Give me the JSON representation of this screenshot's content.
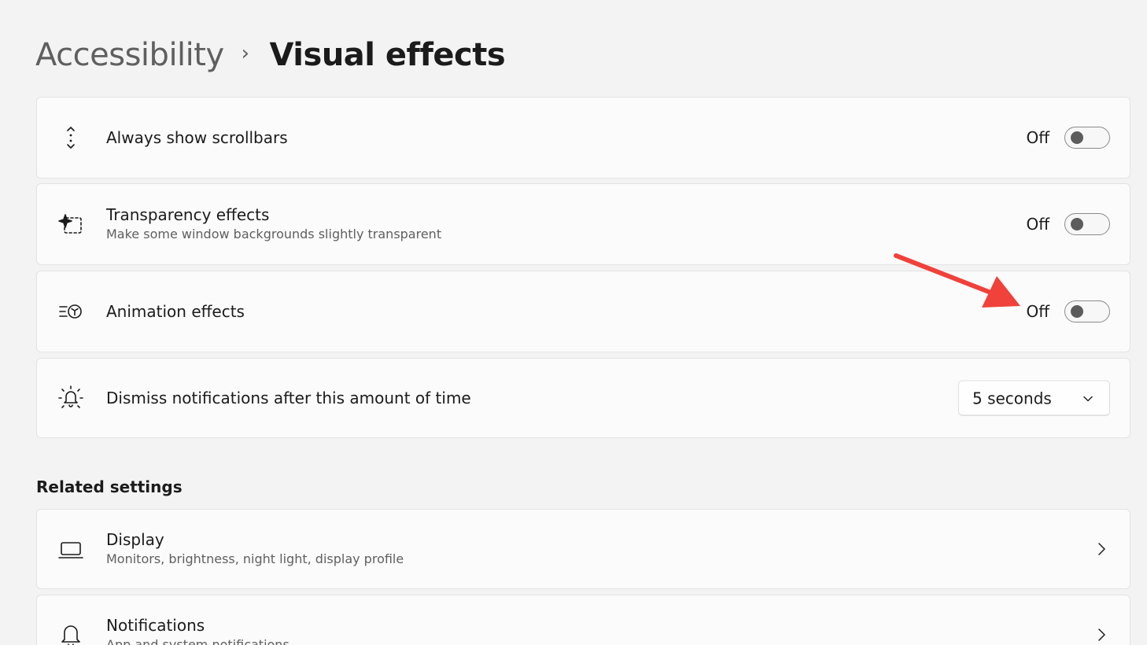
{
  "breadcrumb": {
    "parent": "Accessibility",
    "separator": "›",
    "current": "Visual effects"
  },
  "settings": [
    {
      "icon": "scrollbar-icon",
      "title": "Always show scrollbars",
      "state": "Off",
      "toggle_on": false
    },
    {
      "icon": "transparency-icon",
      "title": "Transparency effects",
      "description": "Make some window backgrounds slightly transparent",
      "state": "Off",
      "toggle_on": false
    },
    {
      "icon": "animation-icon",
      "title": "Animation effects",
      "state": "Off",
      "toggle_on": false
    },
    {
      "icon": "notification-timer-icon",
      "title": "Dismiss notifications after this amount of time",
      "dropdown_value": "5 seconds"
    }
  ],
  "related": {
    "heading": "Related settings",
    "items": [
      {
        "icon": "display-icon",
        "title": "Display",
        "description": "Monitors, brightness, night light, display profile"
      },
      {
        "icon": "bell-icon",
        "title": "Notifications",
        "description": "App and system notifications"
      }
    ]
  },
  "annotation": {
    "icon": "red-arrow-annotation",
    "color": "#f0413a"
  },
  "colors": {
    "background": "#f3f3f3",
    "card": "#fbfbfb",
    "toggle_knob": "#5c5c5c"
  }
}
